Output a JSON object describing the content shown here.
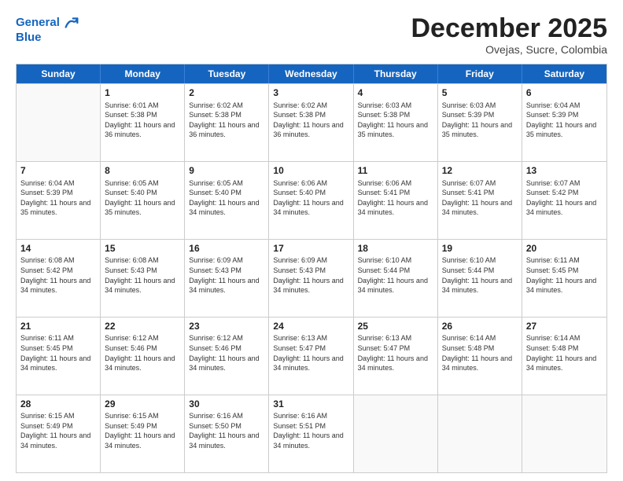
{
  "header": {
    "logo_line1": "General",
    "logo_line2": "Blue",
    "month": "December 2025",
    "location": "Ovejas, Sucre, Colombia"
  },
  "days_of_week": [
    "Sunday",
    "Monday",
    "Tuesday",
    "Wednesday",
    "Thursday",
    "Friday",
    "Saturday"
  ],
  "weeks": [
    [
      {
        "day": "",
        "empty": true
      },
      {
        "day": "1",
        "sunrise": "Sunrise: 6:01 AM",
        "sunset": "Sunset: 5:38 PM",
        "daylight": "Daylight: 11 hours and 36 minutes."
      },
      {
        "day": "2",
        "sunrise": "Sunrise: 6:02 AM",
        "sunset": "Sunset: 5:38 PM",
        "daylight": "Daylight: 11 hours and 36 minutes."
      },
      {
        "day": "3",
        "sunrise": "Sunrise: 6:02 AM",
        "sunset": "Sunset: 5:38 PM",
        "daylight": "Daylight: 11 hours and 36 minutes."
      },
      {
        "day": "4",
        "sunrise": "Sunrise: 6:03 AM",
        "sunset": "Sunset: 5:38 PM",
        "daylight": "Daylight: 11 hours and 35 minutes."
      },
      {
        "day": "5",
        "sunrise": "Sunrise: 6:03 AM",
        "sunset": "Sunset: 5:39 PM",
        "daylight": "Daylight: 11 hours and 35 minutes."
      },
      {
        "day": "6",
        "sunrise": "Sunrise: 6:04 AM",
        "sunset": "Sunset: 5:39 PM",
        "daylight": "Daylight: 11 hours and 35 minutes."
      }
    ],
    [
      {
        "day": "7",
        "sunrise": "Sunrise: 6:04 AM",
        "sunset": "Sunset: 5:39 PM",
        "daylight": "Daylight: 11 hours and 35 minutes."
      },
      {
        "day": "8",
        "sunrise": "Sunrise: 6:05 AM",
        "sunset": "Sunset: 5:40 PM",
        "daylight": "Daylight: 11 hours and 35 minutes."
      },
      {
        "day": "9",
        "sunrise": "Sunrise: 6:05 AM",
        "sunset": "Sunset: 5:40 PM",
        "daylight": "Daylight: 11 hours and 34 minutes."
      },
      {
        "day": "10",
        "sunrise": "Sunrise: 6:06 AM",
        "sunset": "Sunset: 5:40 PM",
        "daylight": "Daylight: 11 hours and 34 minutes."
      },
      {
        "day": "11",
        "sunrise": "Sunrise: 6:06 AM",
        "sunset": "Sunset: 5:41 PM",
        "daylight": "Daylight: 11 hours and 34 minutes."
      },
      {
        "day": "12",
        "sunrise": "Sunrise: 6:07 AM",
        "sunset": "Sunset: 5:41 PM",
        "daylight": "Daylight: 11 hours and 34 minutes."
      },
      {
        "day": "13",
        "sunrise": "Sunrise: 6:07 AM",
        "sunset": "Sunset: 5:42 PM",
        "daylight": "Daylight: 11 hours and 34 minutes."
      }
    ],
    [
      {
        "day": "14",
        "sunrise": "Sunrise: 6:08 AM",
        "sunset": "Sunset: 5:42 PM",
        "daylight": "Daylight: 11 hours and 34 minutes."
      },
      {
        "day": "15",
        "sunrise": "Sunrise: 6:08 AM",
        "sunset": "Sunset: 5:43 PM",
        "daylight": "Daylight: 11 hours and 34 minutes."
      },
      {
        "day": "16",
        "sunrise": "Sunrise: 6:09 AM",
        "sunset": "Sunset: 5:43 PM",
        "daylight": "Daylight: 11 hours and 34 minutes."
      },
      {
        "day": "17",
        "sunrise": "Sunrise: 6:09 AM",
        "sunset": "Sunset: 5:43 PM",
        "daylight": "Daylight: 11 hours and 34 minutes."
      },
      {
        "day": "18",
        "sunrise": "Sunrise: 6:10 AM",
        "sunset": "Sunset: 5:44 PM",
        "daylight": "Daylight: 11 hours and 34 minutes."
      },
      {
        "day": "19",
        "sunrise": "Sunrise: 6:10 AM",
        "sunset": "Sunset: 5:44 PM",
        "daylight": "Daylight: 11 hours and 34 minutes."
      },
      {
        "day": "20",
        "sunrise": "Sunrise: 6:11 AM",
        "sunset": "Sunset: 5:45 PM",
        "daylight": "Daylight: 11 hours and 34 minutes."
      }
    ],
    [
      {
        "day": "21",
        "sunrise": "Sunrise: 6:11 AM",
        "sunset": "Sunset: 5:45 PM",
        "daylight": "Daylight: 11 hours and 34 minutes."
      },
      {
        "day": "22",
        "sunrise": "Sunrise: 6:12 AM",
        "sunset": "Sunset: 5:46 PM",
        "daylight": "Daylight: 11 hours and 34 minutes."
      },
      {
        "day": "23",
        "sunrise": "Sunrise: 6:12 AM",
        "sunset": "Sunset: 5:46 PM",
        "daylight": "Daylight: 11 hours and 34 minutes."
      },
      {
        "day": "24",
        "sunrise": "Sunrise: 6:13 AM",
        "sunset": "Sunset: 5:47 PM",
        "daylight": "Daylight: 11 hours and 34 minutes."
      },
      {
        "day": "25",
        "sunrise": "Sunrise: 6:13 AM",
        "sunset": "Sunset: 5:47 PM",
        "daylight": "Daylight: 11 hours and 34 minutes."
      },
      {
        "day": "26",
        "sunrise": "Sunrise: 6:14 AM",
        "sunset": "Sunset: 5:48 PM",
        "daylight": "Daylight: 11 hours and 34 minutes."
      },
      {
        "day": "27",
        "sunrise": "Sunrise: 6:14 AM",
        "sunset": "Sunset: 5:48 PM",
        "daylight": "Daylight: 11 hours and 34 minutes."
      }
    ],
    [
      {
        "day": "28",
        "sunrise": "Sunrise: 6:15 AM",
        "sunset": "Sunset: 5:49 PM",
        "daylight": "Daylight: 11 hours and 34 minutes."
      },
      {
        "day": "29",
        "sunrise": "Sunrise: 6:15 AM",
        "sunset": "Sunset: 5:49 PM",
        "daylight": "Daylight: 11 hours and 34 minutes."
      },
      {
        "day": "30",
        "sunrise": "Sunrise: 6:16 AM",
        "sunset": "Sunset: 5:50 PM",
        "daylight": "Daylight: 11 hours and 34 minutes."
      },
      {
        "day": "31",
        "sunrise": "Sunrise: 6:16 AM",
        "sunset": "Sunset: 5:51 PM",
        "daylight": "Daylight: 11 hours and 34 minutes."
      },
      {
        "day": "",
        "empty": true
      },
      {
        "day": "",
        "empty": true
      },
      {
        "day": "",
        "empty": true
      }
    ]
  ]
}
